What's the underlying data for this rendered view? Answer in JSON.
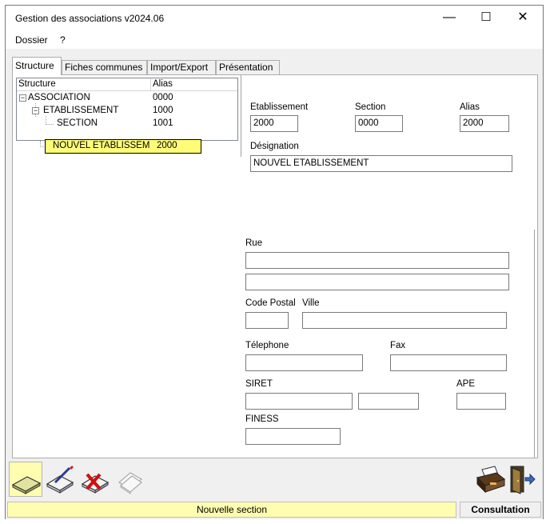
{
  "window": {
    "title": "Gestion des associations v2024.06",
    "minimize_glyph": "—",
    "maximize_glyph": "☐",
    "close_glyph": "✕"
  },
  "menu": {
    "items": [
      "Dossier",
      "?"
    ]
  },
  "tabs": [
    "Structure",
    "Fiches communes",
    "Import/Export",
    "Présentation"
  ],
  "tree": {
    "columns": [
      "Structure",
      "Alias"
    ],
    "rows": [
      {
        "name": "ASSOCIATION",
        "alias": "0000"
      },
      {
        "name": "ETABLISSEMENT",
        "alias": "1000"
      },
      {
        "name": "SECTION",
        "alias": "1001"
      },
      {
        "name": "NOUVEL ETABLISSEM",
        "alias": "2000"
      }
    ],
    "expand_glyph": "−"
  },
  "form": {
    "etablissement": {
      "label": "Etablissement",
      "value": "2000"
    },
    "section": {
      "label": "Section",
      "value": "0000"
    },
    "alias": {
      "label": "Alias",
      "value": "2000"
    },
    "designation": {
      "label": "Désignation",
      "value": "NOUVEL ETABLISSEMENT"
    },
    "rue": {
      "label": "Rue",
      "line1": "",
      "line2": ""
    },
    "code_postal": {
      "label": "Code Postal",
      "value": ""
    },
    "ville": {
      "label": "Ville",
      "value": ""
    },
    "telephone": {
      "label": "Télephone",
      "value": ""
    },
    "fax": {
      "label": "Fax",
      "value": ""
    },
    "siret": {
      "label": "SIRET",
      "value1": "",
      "value2": ""
    },
    "ape": {
      "label": "APE",
      "value": ""
    },
    "finess": {
      "label": "FINESS",
      "value": ""
    }
  },
  "toolbar": {
    "left_buttons": [
      "new-record-icon",
      "edit-record-icon",
      "delete-record-icon",
      "copy-record-icon"
    ],
    "right_buttons": [
      "print-icon",
      "exit-door-icon"
    ]
  },
  "status": {
    "message": "Nouvelle section",
    "mode": "Consultation"
  },
  "colors": {
    "highlight": "#fffd78",
    "status_bg": "#fffeb0"
  }
}
